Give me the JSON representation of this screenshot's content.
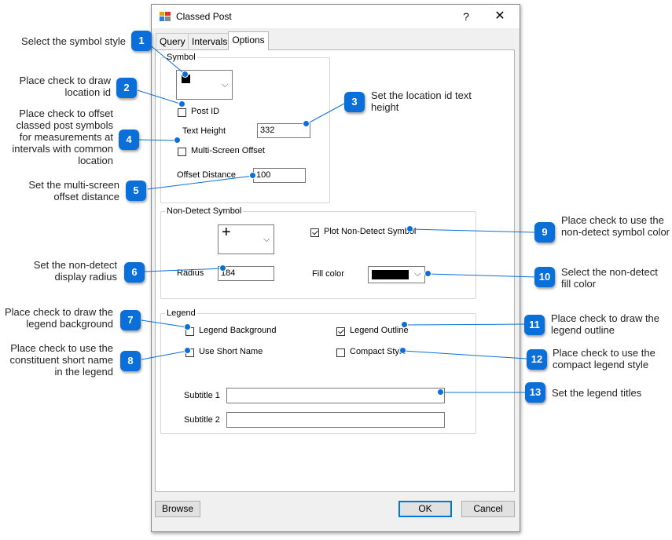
{
  "dialog": {
    "title": "Classed Post",
    "help_label": "?",
    "close_label": "✕",
    "tabs": [
      {
        "label": "Query"
      },
      {
        "label": "Intervals"
      },
      {
        "label": "Options",
        "active": true
      }
    ]
  },
  "symbol": {
    "group_label": "Symbol",
    "post_id_label": "Post ID",
    "post_id_checked": false,
    "text_height_label": "Text Height",
    "text_height_value": "332",
    "multiscreen_label": "Multi-Screen Offset",
    "multiscreen_checked": false,
    "offset_label": "Offset Distance",
    "offset_value": "100"
  },
  "nondetect": {
    "group_label": "Non-Detect Symbol",
    "symbol_glyph": "+",
    "plot_label": "Plot Non-Detect Symbol",
    "plot_checked": true,
    "radius_label": "Radius",
    "radius_value": "184",
    "fill_label": "Fill color",
    "fill_color": "#000000"
  },
  "legend": {
    "group_label": "Legend",
    "background_label": "Legend Background",
    "background_checked": false,
    "outline_label": "Legend Outline",
    "outline_checked": true,
    "short_name_label": "Use Short Name",
    "short_name_checked": false,
    "compact_label": "Compact Style",
    "compact_checked": false,
    "subtitle1_label": "Subtitle 1",
    "subtitle1_value": "",
    "subtitle2_label": "Subtitle 2",
    "subtitle2_value": ""
  },
  "footer": {
    "browse_label": "Browse",
    "ok_label": "OK",
    "cancel_label": "Cancel"
  },
  "callouts": [
    {
      "num": "1",
      "text": "Select the symbol style"
    },
    {
      "num": "2",
      "text": "Place check to draw location id"
    },
    {
      "num": "3",
      "text": "Set the location id text height"
    },
    {
      "num": "4",
      "text": "Place check to offset classed post symbols for measurements at intervals with common location"
    },
    {
      "num": "5",
      "text": "Set the multi-screen offset distance"
    },
    {
      "num": "6",
      "text": "Set the non-detect display radius"
    },
    {
      "num": "7",
      "text": "Place check to draw the legend background"
    },
    {
      "num": "8",
      "text": "Place check to use the constituent short name in the legend"
    },
    {
      "num": "9",
      "text": "Place check to use the non-detect symbol color"
    },
    {
      "num": "10",
      "text": "Select the non-detect fill color"
    },
    {
      "num": "11",
      "text": "Place check to draw the legend outline"
    },
    {
      "num": "12",
      "text": "Place check to use the compact legend style"
    },
    {
      "num": "13",
      "text": "Set the legend titles"
    }
  ],
  "colors": {
    "callout_blue": "#0a6fd8",
    "fill_swatch": "#000000"
  }
}
